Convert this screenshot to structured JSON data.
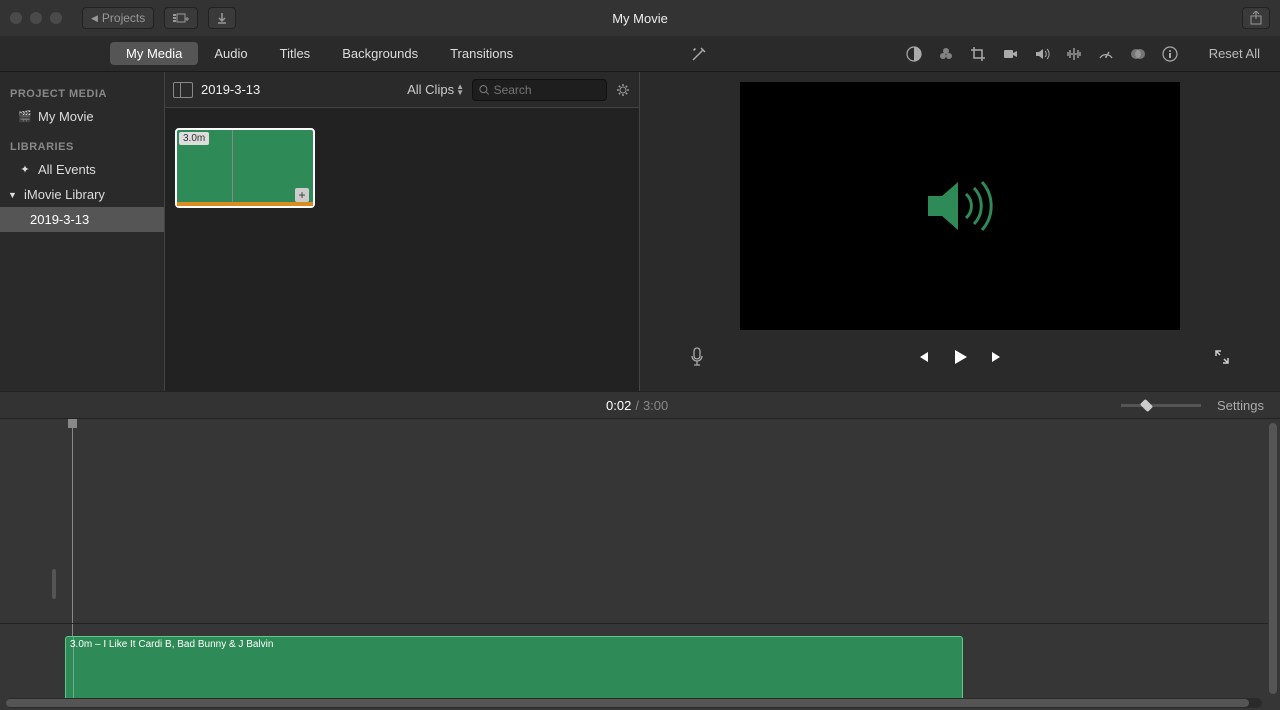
{
  "titlebar": {
    "back_label": "Projects",
    "title": "My Movie"
  },
  "tabs": {
    "my_media": "My Media",
    "audio": "Audio",
    "titles": "Titles",
    "backgrounds": "Backgrounds",
    "transitions": "Transitions"
  },
  "toolbar_right": {
    "reset": "Reset All"
  },
  "sidebar": {
    "project_media_heading": "PROJECT MEDIA",
    "my_movie": "My Movie",
    "libraries_heading": "LIBRARIES",
    "all_events": "All Events",
    "imovie_library": "iMovie Library",
    "event_date": "2019-3-13"
  },
  "browser": {
    "event_name": "2019-3-13",
    "filter": "All Clips",
    "search_placeholder": "Search",
    "clip_duration": "3.0m"
  },
  "timebar": {
    "current": "0:02",
    "sep": "/",
    "total": "3:00",
    "settings": "Settings"
  },
  "timeline": {
    "audio_clip_label": "3.0m – I Like It Cardi B, Bad Bunny & J Balvin"
  }
}
